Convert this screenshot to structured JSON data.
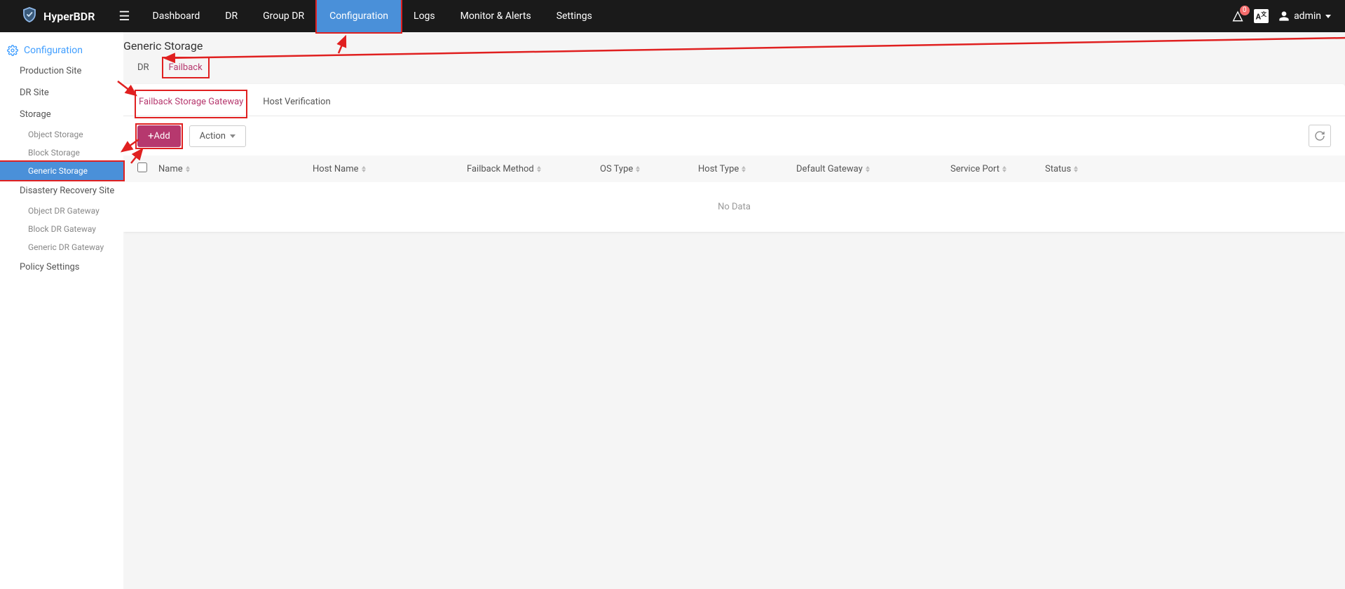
{
  "brand": "HyperBDR",
  "nav": {
    "dashboard": "Dashboard",
    "dr": "DR",
    "groupdr": "Group DR",
    "configuration": "Configuration",
    "logs": "Logs",
    "monitor": "Monitor & Alerts",
    "settings": "Settings"
  },
  "top_right": {
    "notif_count": "0",
    "lang": "A",
    "user": "admin"
  },
  "sidebar": {
    "header": "Configuration",
    "items": {
      "production_site": "Production Site",
      "dr_site": "DR Site",
      "storage": "Storage",
      "object_storage": "Object Storage",
      "block_storage": "Block Storage",
      "generic_storage": "Generic Storage",
      "recovery_site": "Disastery Recovery Site",
      "object_dr_gw": "Object DR Gateway",
      "block_dr_gw": "Block DR Gateway",
      "generic_dr_gw": "Generic DR Gateway",
      "policy": "Policy Settings"
    }
  },
  "main": {
    "title": "Generic Storage",
    "tabs1": {
      "dr": "DR",
      "failback": "Failback"
    },
    "tabs2": {
      "gateway": "Failback Storage Gateway",
      "verification": "Host Verification"
    },
    "buttons": {
      "add": "Add",
      "action": "Action"
    },
    "columns": {
      "name": "Name",
      "host": "Host Name",
      "method": "Failback Method",
      "os": "OS Type",
      "htype": "Host Type",
      "gateway": "Default Gateway",
      "port": "Service Port",
      "status": "Status"
    },
    "no_data": "No Data"
  }
}
